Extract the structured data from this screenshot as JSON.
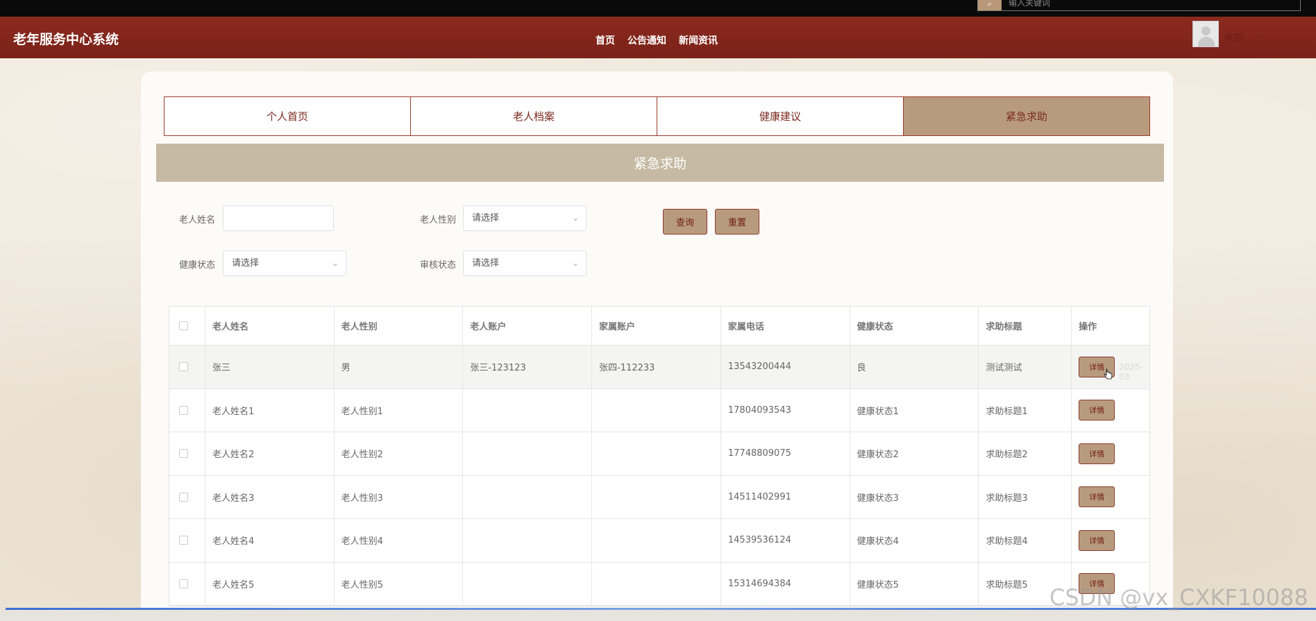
{
  "topbar": {
    "search_placeholder": "输入关键词"
  },
  "header": {
    "brand": "老年服务中心系统",
    "nav": [
      "首页",
      "公告通知",
      "新闻资讯"
    ],
    "username": "张四"
  },
  "tabs": [
    {
      "label": "个人首页",
      "active": false
    },
    {
      "label": "老人档案",
      "active": false
    },
    {
      "label": "健康建议",
      "active": false
    },
    {
      "label": "紧急求助",
      "active": true
    }
  ],
  "section_title": "紧急求助",
  "filters": {
    "name_label": "老人姓名",
    "name_value": "",
    "gender_label": "老人性别",
    "gender_value": "请选择",
    "health_label": "健康状态",
    "health_value": "请选择",
    "audit_label": "审核状态",
    "audit_value": "请选择",
    "query_label": "查询",
    "reset_label": "重置"
  },
  "table": {
    "headers": [
      "老人姓名",
      "老人性别",
      "老人账户",
      "家属账户",
      "家属电话",
      "健康状态",
      "求助标题",
      "操作"
    ],
    "detail_label": "详情",
    "ghost_date": "2025-03",
    "rows": [
      [
        "张三",
        "男",
        "张三-123123",
        "张四-112233",
        "13543200444",
        "良",
        "测试测试"
      ],
      [
        "老人姓名1",
        "老人性别1",
        "",
        "",
        "17804093543",
        "健康状态1",
        "求助标题1"
      ],
      [
        "老人姓名2",
        "老人性别2",
        "",
        "",
        "17748809075",
        "健康状态2",
        "求助标题2"
      ],
      [
        "老人姓名3",
        "老人性别3",
        "",
        "",
        "14511402991",
        "健康状态3",
        "求助标题3"
      ],
      [
        "老人姓名4",
        "老人性别4",
        "",
        "",
        "14539536124",
        "健康状态4",
        "求助标题4"
      ],
      [
        "老人姓名5",
        "老人性别5",
        "",
        "",
        "15314694384",
        "健康状态5",
        "求助标题5"
      ]
    ]
  },
  "watermark": "CSDN @vx_CXKF10088",
  "colors": {
    "header": "#8b2a1f",
    "accent": "#b89b7f",
    "section": "#c6baa4"
  }
}
